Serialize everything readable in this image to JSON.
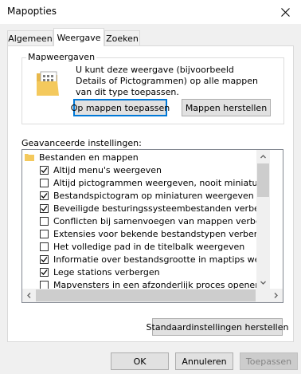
{
  "window": {
    "title": "Mapopties",
    "close_icon": "close-icon"
  },
  "tabs": [
    {
      "label": "Algemeen",
      "selected": false
    },
    {
      "label": "Weergave",
      "selected": true
    },
    {
      "label": "Zoeken",
      "selected": false
    }
  ],
  "folder_views": {
    "title": "Mapweergaven",
    "description": "U kunt deze weergave (bijvoorbeeld Details of Pictogrammen) op alle mappen van dit type toepassen.",
    "apply_button": "Op mappen toepassen",
    "reset_button": "Mappen herstellen"
  },
  "advanced": {
    "label": "Geavanceerde instellingen:",
    "items": [
      {
        "type": "folder",
        "label": "Bestanden en mappen"
      },
      {
        "type": "checkbox",
        "label": "Altijd menu's weergeven",
        "checked": true
      },
      {
        "type": "checkbox",
        "label": "Altijd pictogrammen weergeven, nooit miniaturen",
        "checked": false
      },
      {
        "type": "checkbox",
        "label": "Bestandspictogram op miniaturen weergeven",
        "checked": true
      },
      {
        "type": "checkbox",
        "label": "Beveiligde besturingssysteembestanden verbergen (aanb",
        "checked": true
      },
      {
        "type": "checkbox",
        "label": "Conflicten bij samenvoegen van mappen verbergen",
        "checked": false
      },
      {
        "type": "checkbox",
        "label": "Extensies voor bekende bestandstypen verbergen",
        "checked": false
      },
      {
        "type": "checkbox",
        "label": "Het volledige pad in de titelbalk weergeven",
        "checked": false
      },
      {
        "type": "checkbox",
        "label": "Informatie over bestandsgrootte in maptips weergeven",
        "checked": true
      },
      {
        "type": "checkbox",
        "label": "Lege stations verbergen",
        "checked": true
      },
      {
        "type": "checkbox",
        "label": "Mapvensters in een afzonderlijk proces openen",
        "checked": false
      }
    ],
    "restore_defaults_button": "Standaardinstellingen herstellen"
  },
  "footer": {
    "ok": "OK",
    "cancel": "Annuleren",
    "apply": "Toepassen"
  },
  "colors": {
    "accent": "#0078d7",
    "folder": "#f4c95d"
  }
}
